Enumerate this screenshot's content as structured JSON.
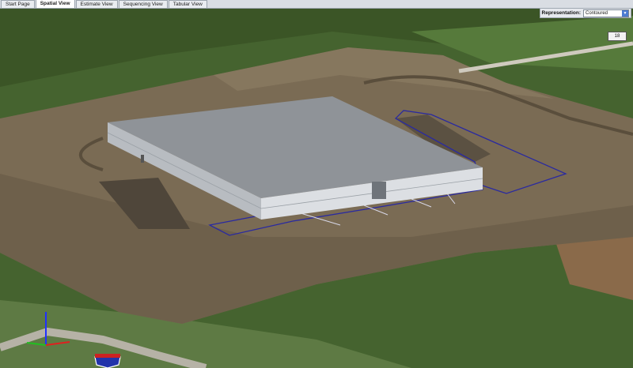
{
  "tabs": [
    {
      "label": "Start Page",
      "active": false
    },
    {
      "label": "Spatial View",
      "active": true
    },
    {
      "label": "Estimate View",
      "active": false
    },
    {
      "label": "Sequencing View",
      "active": false
    },
    {
      "label": "Tabular View",
      "active": false
    }
  ],
  "representation": {
    "label": "Representation:",
    "value": "Contoured"
  },
  "route_sign": "18",
  "colors": {
    "terrain": "#7a6a52",
    "vegetation": "#3f5f2c",
    "building_roof": "#8a8f95",
    "site_outline": "#2a2aa0"
  }
}
